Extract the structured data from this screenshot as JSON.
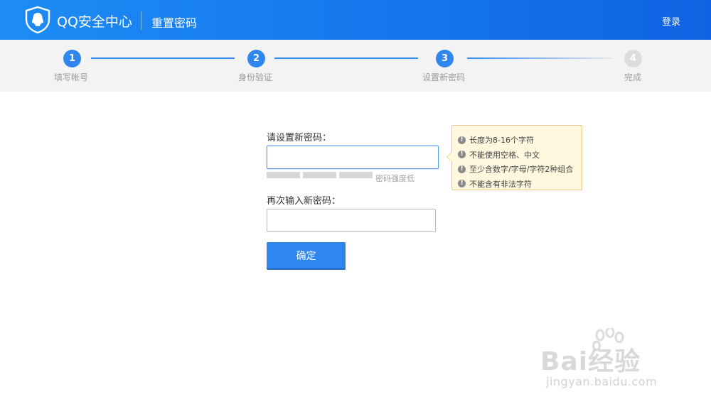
{
  "header": {
    "brand": "QQ安全中心",
    "page_name": "重置密码",
    "login_label": "登录"
  },
  "steps": [
    {
      "number": "1",
      "label": "填写帐号",
      "state": "done"
    },
    {
      "number": "2",
      "label": "身份验证",
      "state": "done"
    },
    {
      "number": "3",
      "label": "设置新密码",
      "state": "current"
    },
    {
      "number": "4",
      "label": "完成",
      "state": "pending"
    }
  ],
  "form": {
    "new_password_label": "请设置新密码：",
    "new_password_value": "",
    "strength_text": "密码强度低",
    "confirm_password_label": "再次输入新密码：",
    "confirm_password_value": "",
    "submit_label": "确定"
  },
  "tooltip": {
    "rules": [
      "长度为8-16个字符",
      "不能使用空格、中文",
      "至少含数字/字母/字符2种组合",
      "不能含有非法字符"
    ]
  },
  "watermark": {
    "text": "Bai经验",
    "url": "jingyan.baidu.com"
  },
  "colors": {
    "header": "#1577ec",
    "accent": "#2f86ee",
    "steps_bg": "#f3f3f3",
    "tip_bg": "#fff8de",
    "tip_border": "#e7c98a"
  }
}
